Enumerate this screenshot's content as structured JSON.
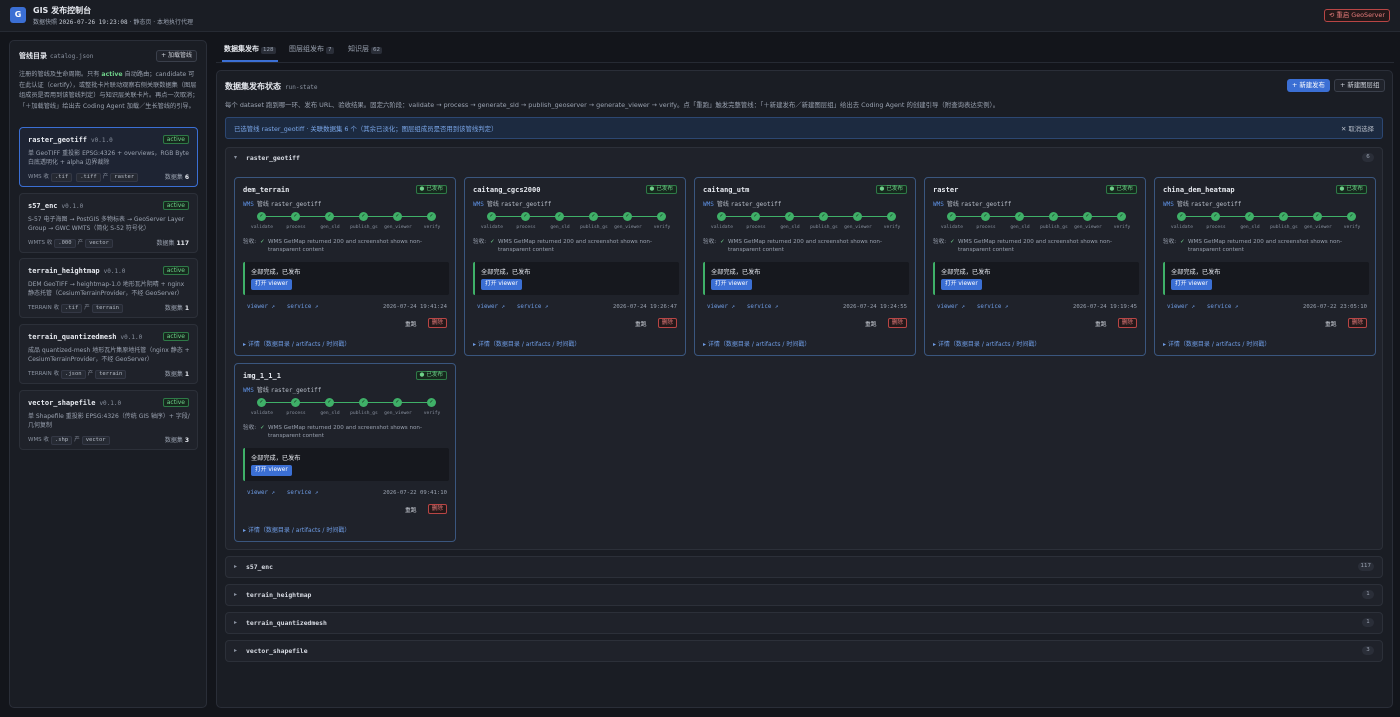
{
  "app": {
    "logo": "G",
    "title": "GIS 发布控制台",
    "sub_label": "数据快照",
    "snapshot_time": "2026-07-26 19:23:08",
    "sub_suffix": "· 静态页 · 本地执行代理",
    "restart_label": "⟲ 重启 GeoServer"
  },
  "sidebar": {
    "title": "管线目录",
    "file": "catalog.json",
    "add_label": "+ 加载管线",
    "desc_pre": "注册的管线及生命周期。只有",
    "desc_active": "active",
    "desc_post": "自动路由；candidate 可在此认证（certify），或整批卡片联动观察右侧关联数据集（图层组成员是否用到该管线判定）与知识层关联卡片。再点一次取消；「＋加载管线」给出去 Coding Agent 加载／生长管线的引导。",
    "pipelines": [
      {
        "name": "raster_geotiff",
        "version": "v0.1.0",
        "status": "active",
        "desc": "单 GeoTIFF 重投影 EPSG:4326 + overviews，RGB Byte 白底透明化 + alpha 边界裁除",
        "in_label": "WMS 收",
        "inputs": [
          ".tif",
          ".tiff"
        ],
        "out_label": "产",
        "output": "raster",
        "count_label": "数据集",
        "count": "6"
      },
      {
        "name": "s57_enc",
        "version": "v0.1.0",
        "status": "active",
        "desc": "S-57 电子海图 → PostGIS 多物标表 → GeoServer Layer Group → GWC WMTS（简化 S-52 符号化）",
        "in_label": "WMTS 收",
        "inputs": [
          ".000"
        ],
        "out_label": "产",
        "output": "vector",
        "count_label": "数据集",
        "count": "117"
      },
      {
        "name": "terrain_heightmap",
        "version": "v0.1.0",
        "status": "active",
        "desc": "DEM GeoTIFF → heightmap-1.0 地形瓦片阴晴 + nginx 静态托管（CesiumTerrainProvider，不经 GeoServer）",
        "in_label": "TERRAIN 收",
        "inputs": [
          ".tif"
        ],
        "out_label": "产",
        "output": "terrain",
        "count_label": "数据集",
        "count": "1"
      },
      {
        "name": "terrain_quantizedmesh",
        "version": "v0.1.0",
        "status": "active",
        "desc": "成品 quantized-mesh 地形瓦片集原地托管（nginx 静态 + CesiumTerrainProvider，不经 GeoServer）",
        "in_label": "TERRAIN 收",
        "inputs": [
          ".json"
        ],
        "out_label": "产",
        "output": "terrain",
        "count_label": "数据集",
        "count": "1"
      },
      {
        "name": "vector_shapefile",
        "version": "v0.1.0",
        "status": "active",
        "desc": "单 Shapefile 重投影 EPSG:4326（传统 GIS 轴序）+ 字段/几何复制",
        "in_label": "WMS 收",
        "inputs": [
          ".shp"
        ],
        "out_label": "产",
        "output": "vector",
        "count_label": "数据集",
        "count": "3"
      }
    ]
  },
  "tabs": [
    {
      "label": "数据集发布",
      "count": "128"
    },
    {
      "label": "图层组发布",
      "count": "7"
    },
    {
      "label": "知识层",
      "count": "62"
    }
  ],
  "main": {
    "title": "数据集发布状态",
    "subtitle": "run-state",
    "new_label": "+ 新建发布",
    "group_label": "+ 新建图层组",
    "desc": "每个 dataset 跑到哪一环、发布 URL、验收结果。固定六阶段：validate → process → generate_sld → publish_geoserver → generate_viewer → verify。点「重跑」触发完整管线：「＋新建发布／新建图层组」给出去 Coding Agent 的创建引导（附查询表达实例）。",
    "selection_text": "已选管线 raster_geotiff · 关联数据集 6 个（其余已淡化；图层组成员是否用到该管线判定）",
    "clear_label": "✕ 取消选择"
  },
  "groups": [
    {
      "name": "raster_geotiff",
      "count": "6",
      "expanded": true
    },
    {
      "name": "s57_enc",
      "count": "117"
    },
    {
      "name": "terrain_heightmap",
      "count": "1"
    },
    {
      "name": "terrain_quantizedmesh",
      "count": "1"
    },
    {
      "name": "vector_shapefile",
      "count": "3"
    }
  ],
  "steps": [
    "validate",
    "process",
    "gen_sld",
    "publish_gs",
    "gen_viewer",
    "verify"
  ],
  "datasets": [
    {
      "name": "dem_terrain",
      "time": "2026-07-24 19:41:24"
    },
    {
      "name": "caitang_cgcs2000",
      "time": "2026-07-24 19:26:47"
    },
    {
      "name": "caitang_utm",
      "time": "2026-07-24 19:24:55"
    },
    {
      "name": "raster",
      "time": "2026-07-24 19:19:45"
    },
    {
      "name": "china_dem_heatmap",
      "time": "2026-07-22 23:05:10"
    },
    {
      "name": "img_1_1_1",
      "time": "2026-07-22 09:41:10"
    }
  ],
  "ds_common": {
    "status": "● 已发布",
    "service_type": "WMS",
    "pipe_prefix": "管线",
    "pipe_name": "raster_geotiff",
    "verify_label": "验收:",
    "verify_msg": "WMS GetMap returned 200 and screenshot shows non-transparent content",
    "done_text": "全部完成，已发布",
    "open_label": "打开 viewer",
    "viewer_link": "viewer ↗",
    "service_link": "service ↗",
    "rerun_label": "重跑",
    "delete_label": "删除",
    "detail_label": "▸ 详情（数据目录 / artifacts / 时间戳）"
  }
}
